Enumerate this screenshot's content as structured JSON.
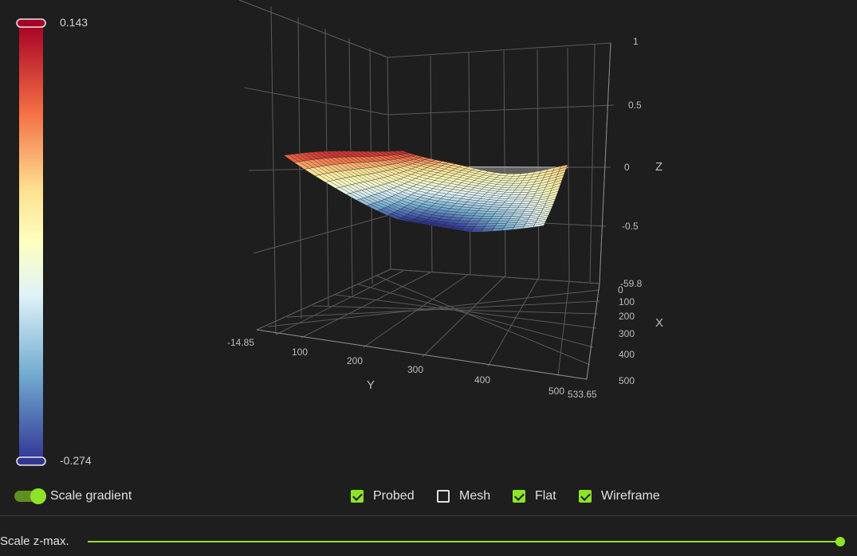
{
  "chart_data": {
    "type": "surface3d",
    "title": "",
    "axes": {
      "x": {
        "label": "X",
        "range": [
          -59.8,
          533.65
        ],
        "ticks": [
          "-59.8",
          "0",
          "100",
          "200",
          "300",
          "400",
          "500"
        ]
      },
      "y": {
        "label": "Y",
        "range": [
          -14.85,
          533.65
        ],
        "ticks": [
          "-14.85",
          "100",
          "200",
          "300",
          "400",
          "500",
          "533.65"
        ]
      },
      "z": {
        "label": "Z",
        "range": [
          -1,
          1
        ],
        "ticks": [
          "1",
          "0.5",
          "0",
          "-0.5"
        ]
      }
    },
    "colorbar": {
      "max": "0.143",
      "min": "-0.274",
      "colors": [
        "#a50026",
        "#f46d43",
        "#fee090",
        "#ffffbf",
        "#e0f3f8",
        "#74add1",
        "#313695"
      ]
    },
    "surface": {
      "grid_size": [
        26,
        26
      ],
      "z_min": -0.274,
      "z_max": 0.143,
      "description_values": {
        "corner_y0_x0": 0.1,
        "corner_y0_xmax": 0.14,
        "corner_ymax_x0": -0.12,
        "corner_ymax_xmax": 0.02,
        "center": -0.25
      }
    },
    "flat_plane_z": 0,
    "grid": true
  },
  "controls": {
    "scale_gradient": {
      "label": "Scale gradient",
      "on": true
    },
    "checkboxes": [
      {
        "label": "Probed",
        "checked": true
      },
      {
        "label": "Mesh",
        "checked": false
      },
      {
        "label": "Flat",
        "checked": true
      },
      {
        "label": "Wireframe",
        "checked": true
      }
    ],
    "scale_zmax": {
      "label": "Scale z-max.",
      "value_fraction": 1.0
    }
  },
  "colors": {
    "accent": "#8fe326",
    "background": "#1e1e1e"
  }
}
